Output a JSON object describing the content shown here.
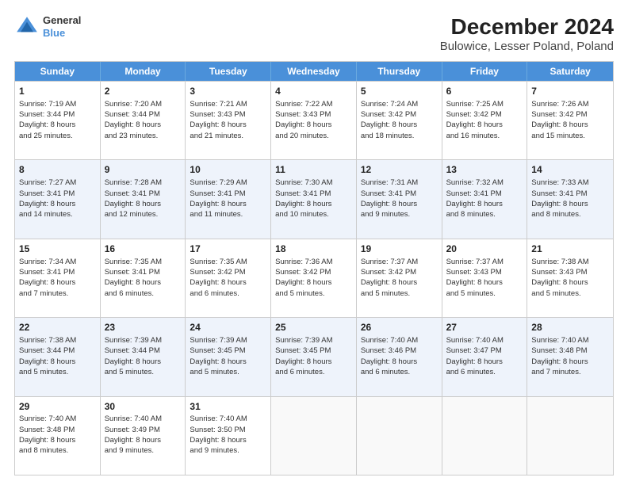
{
  "header": {
    "logo": {
      "line1": "General",
      "line2": "Blue"
    },
    "title": "December 2024",
    "subtitle": "Bulowice, Lesser Poland, Poland"
  },
  "weekdays": [
    "Sunday",
    "Monday",
    "Tuesday",
    "Wednesday",
    "Thursday",
    "Friday",
    "Saturday"
  ],
  "rows": [
    [
      {
        "day": "1",
        "lines": [
          "Sunrise: 7:19 AM",
          "Sunset: 3:44 PM",
          "Daylight: 8 hours",
          "and 25 minutes."
        ]
      },
      {
        "day": "2",
        "lines": [
          "Sunrise: 7:20 AM",
          "Sunset: 3:44 PM",
          "Daylight: 8 hours",
          "and 23 minutes."
        ]
      },
      {
        "day": "3",
        "lines": [
          "Sunrise: 7:21 AM",
          "Sunset: 3:43 PM",
          "Daylight: 8 hours",
          "and 21 minutes."
        ]
      },
      {
        "day": "4",
        "lines": [
          "Sunrise: 7:22 AM",
          "Sunset: 3:43 PM",
          "Daylight: 8 hours",
          "and 20 minutes."
        ]
      },
      {
        "day": "5",
        "lines": [
          "Sunrise: 7:24 AM",
          "Sunset: 3:42 PM",
          "Daylight: 8 hours",
          "and 18 minutes."
        ]
      },
      {
        "day": "6",
        "lines": [
          "Sunrise: 7:25 AM",
          "Sunset: 3:42 PM",
          "Daylight: 8 hours",
          "and 16 minutes."
        ]
      },
      {
        "day": "7",
        "lines": [
          "Sunrise: 7:26 AM",
          "Sunset: 3:42 PM",
          "Daylight: 8 hours",
          "and 15 minutes."
        ]
      }
    ],
    [
      {
        "day": "8",
        "lines": [
          "Sunrise: 7:27 AM",
          "Sunset: 3:41 PM",
          "Daylight: 8 hours",
          "and 14 minutes."
        ]
      },
      {
        "day": "9",
        "lines": [
          "Sunrise: 7:28 AM",
          "Sunset: 3:41 PM",
          "Daylight: 8 hours",
          "and 12 minutes."
        ]
      },
      {
        "day": "10",
        "lines": [
          "Sunrise: 7:29 AM",
          "Sunset: 3:41 PM",
          "Daylight: 8 hours",
          "and 11 minutes."
        ]
      },
      {
        "day": "11",
        "lines": [
          "Sunrise: 7:30 AM",
          "Sunset: 3:41 PM",
          "Daylight: 8 hours",
          "and 10 minutes."
        ]
      },
      {
        "day": "12",
        "lines": [
          "Sunrise: 7:31 AM",
          "Sunset: 3:41 PM",
          "Daylight: 8 hours",
          "and 9 minutes."
        ]
      },
      {
        "day": "13",
        "lines": [
          "Sunrise: 7:32 AM",
          "Sunset: 3:41 PM",
          "Daylight: 8 hours",
          "and 8 minutes."
        ]
      },
      {
        "day": "14",
        "lines": [
          "Sunrise: 7:33 AM",
          "Sunset: 3:41 PM",
          "Daylight: 8 hours",
          "and 8 minutes."
        ]
      }
    ],
    [
      {
        "day": "15",
        "lines": [
          "Sunrise: 7:34 AM",
          "Sunset: 3:41 PM",
          "Daylight: 8 hours",
          "and 7 minutes."
        ]
      },
      {
        "day": "16",
        "lines": [
          "Sunrise: 7:35 AM",
          "Sunset: 3:41 PM",
          "Daylight: 8 hours",
          "and 6 minutes."
        ]
      },
      {
        "day": "17",
        "lines": [
          "Sunrise: 7:35 AM",
          "Sunset: 3:42 PM",
          "Daylight: 8 hours",
          "and 6 minutes."
        ]
      },
      {
        "day": "18",
        "lines": [
          "Sunrise: 7:36 AM",
          "Sunset: 3:42 PM",
          "Daylight: 8 hours",
          "and 5 minutes."
        ]
      },
      {
        "day": "19",
        "lines": [
          "Sunrise: 7:37 AM",
          "Sunset: 3:42 PM",
          "Daylight: 8 hours",
          "and 5 minutes."
        ]
      },
      {
        "day": "20",
        "lines": [
          "Sunrise: 7:37 AM",
          "Sunset: 3:43 PM",
          "Daylight: 8 hours",
          "and 5 minutes."
        ]
      },
      {
        "day": "21",
        "lines": [
          "Sunrise: 7:38 AM",
          "Sunset: 3:43 PM",
          "Daylight: 8 hours",
          "and 5 minutes."
        ]
      }
    ],
    [
      {
        "day": "22",
        "lines": [
          "Sunrise: 7:38 AM",
          "Sunset: 3:44 PM",
          "Daylight: 8 hours",
          "and 5 minutes."
        ]
      },
      {
        "day": "23",
        "lines": [
          "Sunrise: 7:39 AM",
          "Sunset: 3:44 PM",
          "Daylight: 8 hours",
          "and 5 minutes."
        ]
      },
      {
        "day": "24",
        "lines": [
          "Sunrise: 7:39 AM",
          "Sunset: 3:45 PM",
          "Daylight: 8 hours",
          "and 5 minutes."
        ]
      },
      {
        "day": "25",
        "lines": [
          "Sunrise: 7:39 AM",
          "Sunset: 3:45 PM",
          "Daylight: 8 hours",
          "and 6 minutes."
        ]
      },
      {
        "day": "26",
        "lines": [
          "Sunrise: 7:40 AM",
          "Sunset: 3:46 PM",
          "Daylight: 8 hours",
          "and 6 minutes."
        ]
      },
      {
        "day": "27",
        "lines": [
          "Sunrise: 7:40 AM",
          "Sunset: 3:47 PM",
          "Daylight: 8 hours",
          "and 6 minutes."
        ]
      },
      {
        "day": "28",
        "lines": [
          "Sunrise: 7:40 AM",
          "Sunset: 3:48 PM",
          "Daylight: 8 hours",
          "and 7 minutes."
        ]
      }
    ],
    [
      {
        "day": "29",
        "lines": [
          "Sunrise: 7:40 AM",
          "Sunset: 3:48 PM",
          "Daylight: 8 hours",
          "and 8 minutes."
        ]
      },
      {
        "day": "30",
        "lines": [
          "Sunrise: 7:40 AM",
          "Sunset: 3:49 PM",
          "Daylight: 8 hours",
          "and 9 minutes."
        ]
      },
      {
        "day": "31",
        "lines": [
          "Sunrise: 7:40 AM",
          "Sunset: 3:50 PM",
          "Daylight: 8 hours",
          "and 9 minutes."
        ]
      },
      {
        "day": "",
        "lines": []
      },
      {
        "day": "",
        "lines": []
      },
      {
        "day": "",
        "lines": []
      },
      {
        "day": "",
        "lines": []
      }
    ]
  ]
}
